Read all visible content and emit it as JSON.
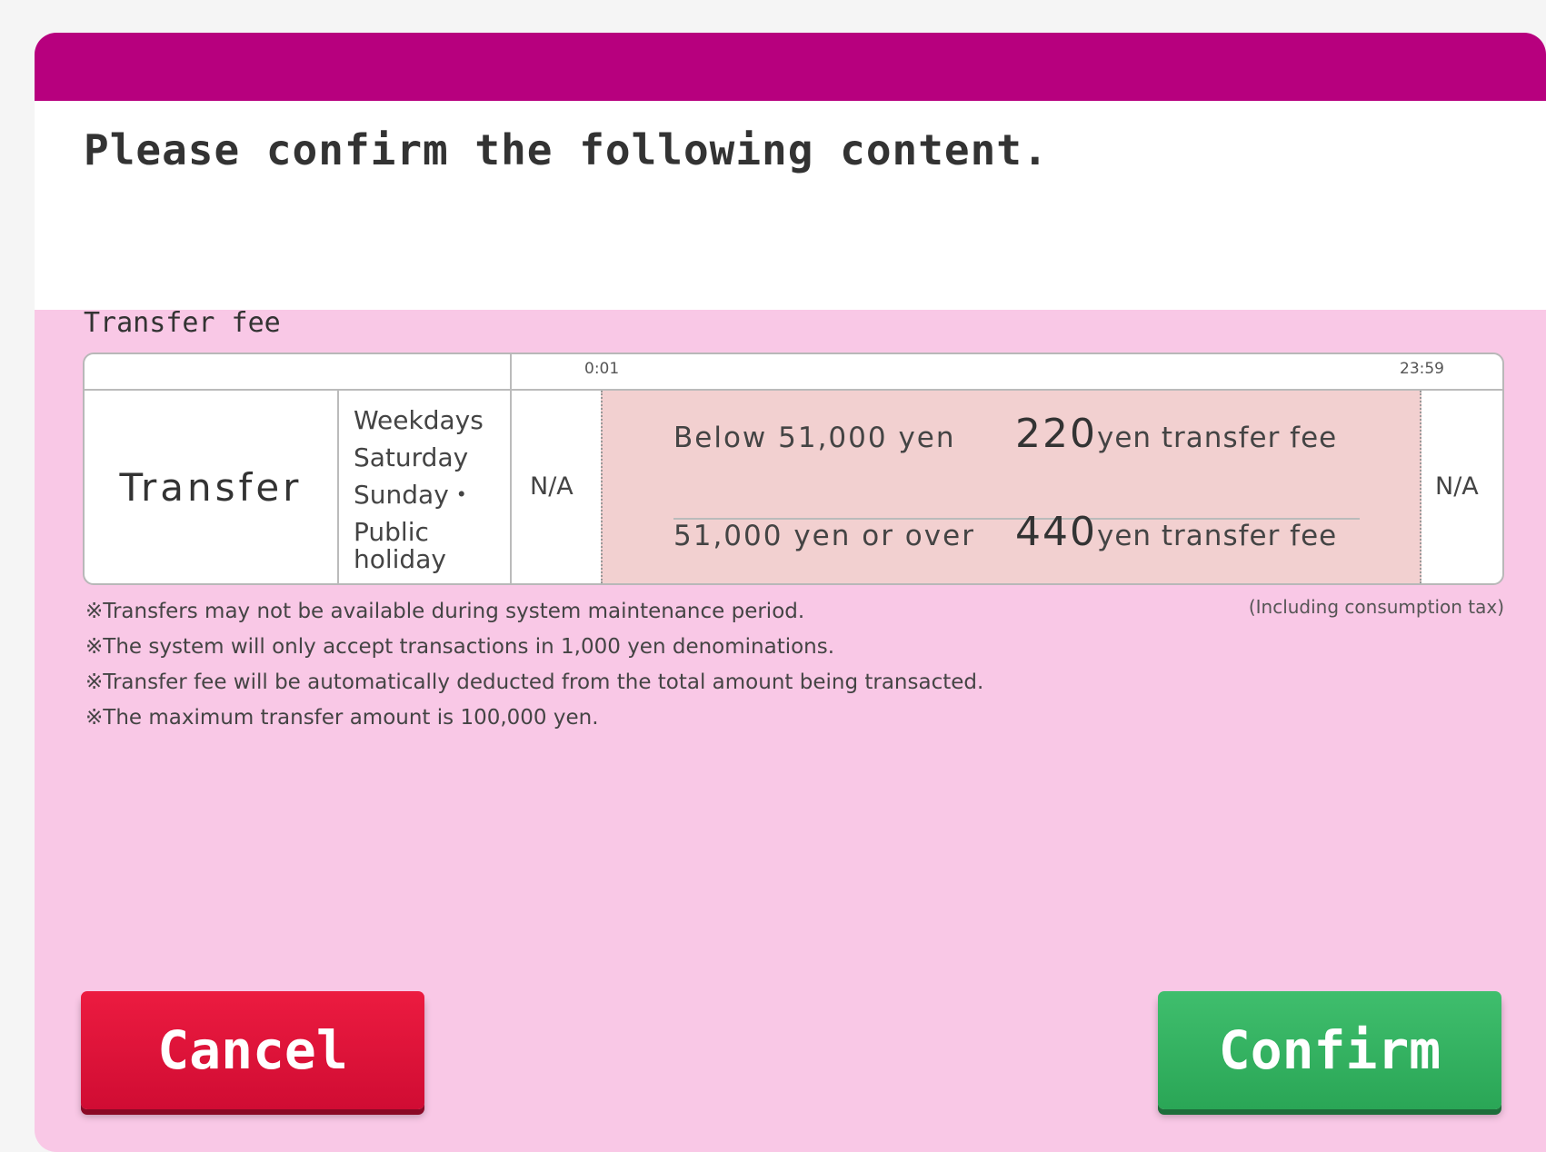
{
  "header": {
    "title": "Please confirm the following content."
  },
  "fee_section": {
    "label": "Transfer fee",
    "time_start": "0:01",
    "time_end": "23:59",
    "service": "Transfer",
    "days": [
      "Weekdays",
      "Saturday",
      "Sunday・",
      "Public",
      "holiday"
    ],
    "before_window": "N/A",
    "after_window": "N/A",
    "tiers": [
      {
        "condition": "Below 51,000 yen",
        "amount": "220",
        "unit": "yen transfer fee"
      },
      {
        "condition": "51,000 yen or over",
        "amount": "440",
        "unit": "yen transfer fee"
      }
    ],
    "tax_note": "(Including consumption tax)"
  },
  "notes": [
    "※Transfers may not be available during system maintenance period.",
    "※The system will only accept transactions in 1,000 yen denominations.",
    "※Transfer fee will be automatically deducted from the total amount being transacted.",
    "※The maximum transfer amount is 100,000 yen."
  ],
  "buttons": {
    "cancel": "Cancel",
    "confirm": "Confirm"
  },
  "colors": {
    "top_bar": "#b7007e",
    "background": "#f9c8e6",
    "fee_band": "#f2d0d0",
    "cancel": "#e0103a",
    "confirm": "#36b463"
  }
}
